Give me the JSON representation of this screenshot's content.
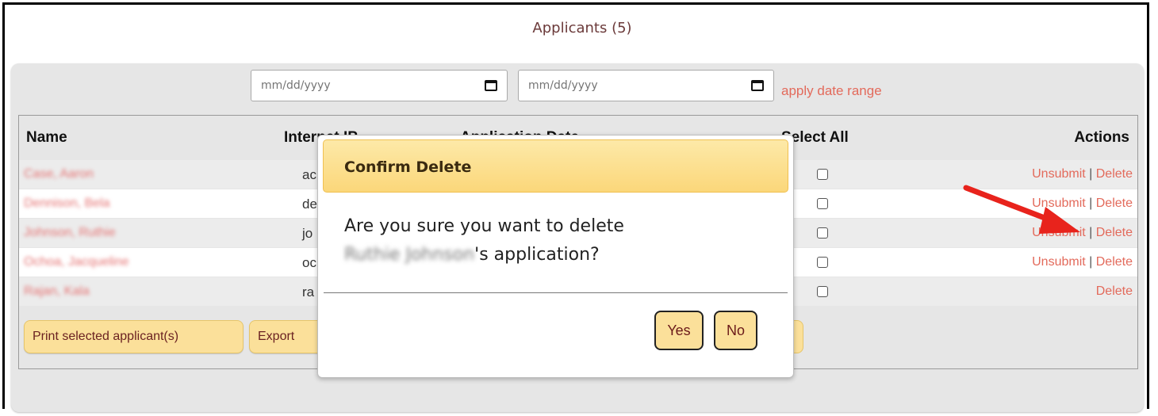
{
  "page": {
    "title": "Applicants (5)"
  },
  "filters": {
    "start_placeholder": "mm/dd/yyyy",
    "end_placeholder": "mm/dd/yyyy",
    "apply_label": "apply date range"
  },
  "table": {
    "headers": {
      "name": "Name",
      "ip": "Internet IP",
      "date": "Application Date",
      "select_all": "Select All",
      "actions": "Actions"
    },
    "rows": [
      {
        "name": "Case, Aaron",
        "ip": "ac",
        "actions": [
          "Unsubmit",
          "Delete"
        ]
      },
      {
        "name": "Dennison, Bela",
        "ip": "de",
        "actions": [
          "Unsubmit",
          "Delete"
        ]
      },
      {
        "name": "Johnson, Ruthie",
        "ip": "jo",
        "actions": [
          "Unsubmit",
          "Delete"
        ]
      },
      {
        "name": "Ochoa, Jacqueline",
        "ip": "oc",
        "actions": [
          "Unsubmit",
          "Delete"
        ]
      },
      {
        "name": "Rajan, Kala",
        "ip": "ra",
        "actions": [
          "Delete"
        ]
      }
    ],
    "separator": "|"
  },
  "buttons": {
    "print": "Print selected applicant(s)",
    "export": "Export"
  },
  "dialog": {
    "title": "Confirm Delete",
    "message_prefix": "Are you sure you want to delete",
    "applicant_name": "Ruthie Johnson",
    "message_suffix": "'s application?",
    "yes": "Yes",
    "no": "No"
  },
  "colors": {
    "link": "#e36a5b",
    "button_bg": "#fbe09a",
    "annotation_arrow": "#e8231c"
  }
}
